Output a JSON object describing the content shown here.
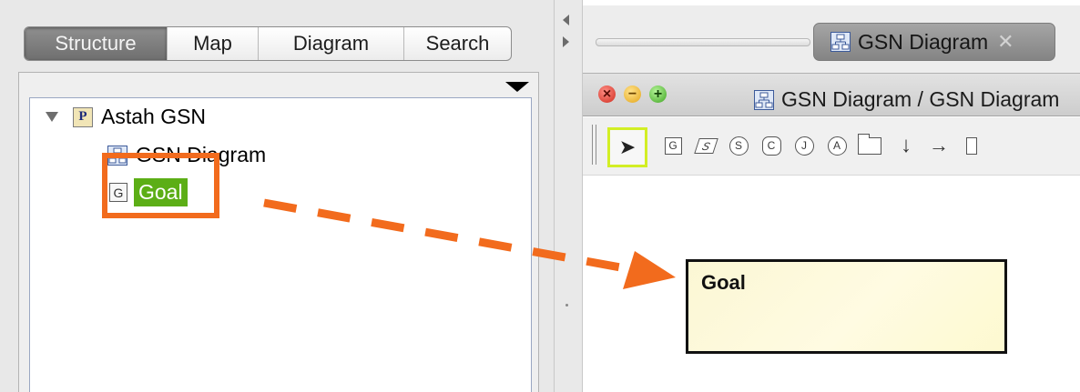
{
  "left_panel": {
    "tabs": [
      {
        "label": "Structure",
        "selected": true
      },
      {
        "label": "Map",
        "selected": false
      },
      {
        "label": "Diagram",
        "selected": false
      },
      {
        "label": "Search",
        "selected": false
      }
    ],
    "tree": {
      "root": {
        "label": "Astah GSN",
        "icon": "project-icon",
        "expanded": true
      },
      "children": [
        {
          "label": "GSN Diagram",
          "icon": "gsn-diagram-icon"
        },
        {
          "label": "Goal",
          "icon": "goal-g-icon",
          "icon_letter": "G",
          "selected": true
        }
      ]
    }
  },
  "diagram_editor": {
    "tab": {
      "label": "GSN Diagram",
      "close_glyph": "✕"
    },
    "title": "GSN Diagram / GSN Diagram",
    "window_controls": {
      "close": "×",
      "minimize": "−",
      "maximize": "+"
    },
    "toolbar": [
      {
        "name": "select-tool",
        "glyph": "➤",
        "active": true
      },
      {
        "name": "goal-tool",
        "glyph": "G"
      },
      {
        "name": "strategy-tool",
        "glyph": "S"
      },
      {
        "name": "solution-tool",
        "glyph": "S"
      },
      {
        "name": "context-tool",
        "glyph": "C"
      },
      {
        "name": "justification-tool",
        "glyph": "J"
      },
      {
        "name": "assumption-tool",
        "glyph": "A"
      },
      {
        "name": "module-tool",
        "glyph": ""
      },
      {
        "name": "supported-by-tool",
        "glyph": "↓"
      },
      {
        "name": "in-context-of-tool",
        "glyph": "→"
      }
    ],
    "canvas": {
      "goal_node": {
        "label": "Goal"
      }
    }
  },
  "colors": {
    "highlight": "#f26b1d",
    "selection_green": "#5cae16",
    "active_tool_border": "#d2ee25",
    "goal_fill": "#fdf9d6"
  }
}
